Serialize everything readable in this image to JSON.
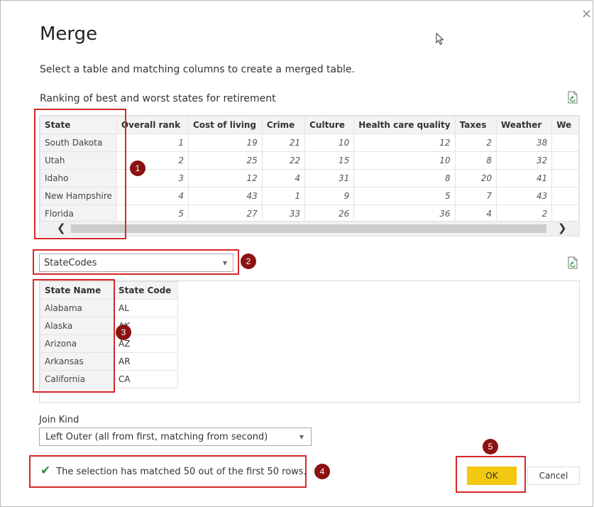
{
  "dialog": {
    "title": "Merge",
    "subtitle": "Select a table and matching columns to create a merged table.",
    "close_glyph": "×"
  },
  "table1": {
    "name": "Ranking of best and worst states for retirement",
    "columns": [
      "State",
      "Overall rank",
      "Cost of living",
      "Crime",
      "Culture",
      "Health care quality",
      "Taxes",
      "Weather",
      "We"
    ],
    "rows": [
      [
        "South Dakota",
        "1",
        "19",
        "21",
        "10",
        "12",
        "2",
        "38",
        ""
      ],
      [
        "Utah",
        "2",
        "25",
        "22",
        "15",
        "10",
        "8",
        "32",
        ""
      ],
      [
        "Idaho",
        "3",
        "12",
        "4",
        "31",
        "8",
        "20",
        "41",
        ""
      ],
      [
        "New Hampshire",
        "4",
        "43",
        "1",
        "9",
        "5",
        "7",
        "43",
        ""
      ],
      [
        "Florida",
        "5",
        "27",
        "33",
        "26",
        "36",
        "4",
        "2",
        ""
      ]
    ]
  },
  "scrollbar": {
    "left_arrow": "❮",
    "right_arrow": "❯"
  },
  "second_table": {
    "selected": "StateCodes",
    "columns": [
      "State Name",
      "State Code"
    ],
    "rows": [
      [
        "Alabama",
        "AL"
      ],
      [
        "Alaska",
        "AK"
      ],
      [
        "Arizona",
        "AZ"
      ],
      [
        "Arkansas",
        "AR"
      ],
      [
        "California",
        "CA"
      ]
    ]
  },
  "join": {
    "label": "Join Kind",
    "value": "Left Outer (all from first, matching from second)"
  },
  "status": {
    "text": "The selection has matched 50 out of the first 50 rows."
  },
  "buttons": {
    "ok": "OK",
    "cancel": "Cancel"
  },
  "badges": [
    "1",
    "2",
    "3",
    "4",
    "5"
  ],
  "colors": {
    "accent": "#f2c811",
    "highlight": "#d62828",
    "badge": "#8b1212",
    "check": "#2e8b3e"
  },
  "icons": [
    "close-icon",
    "refresh-icon",
    "chevron-down-icon",
    "checkmark-icon",
    "mouse-cursor-icon"
  ]
}
